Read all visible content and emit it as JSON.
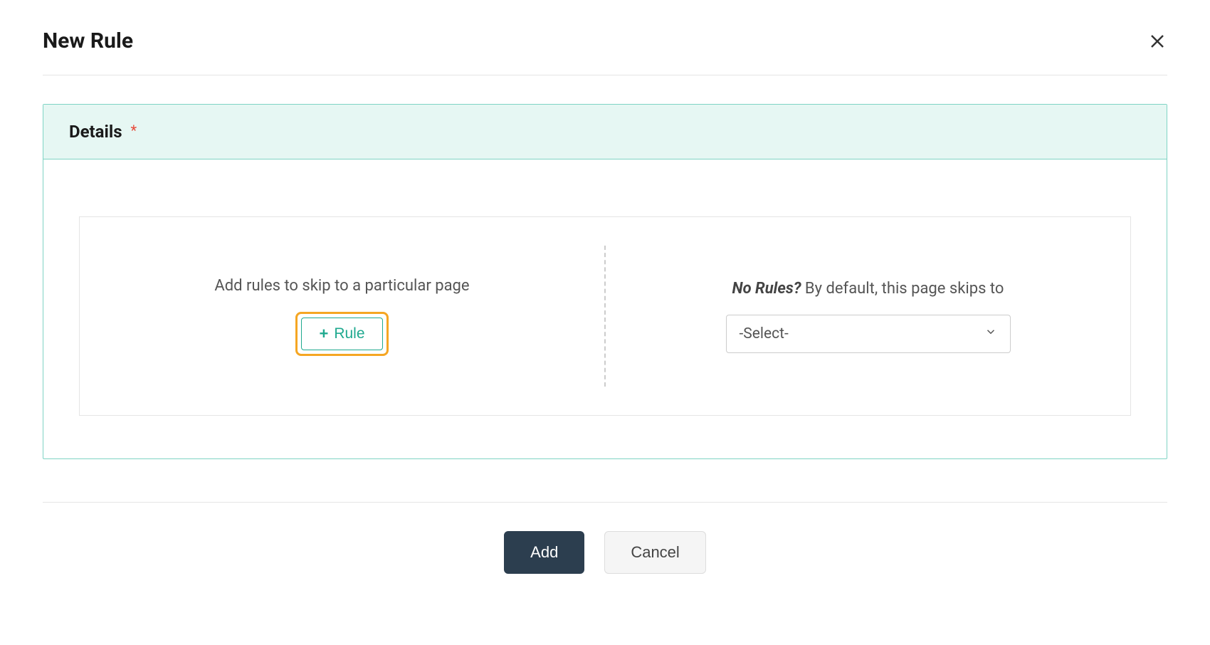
{
  "modal": {
    "title": "New Rule"
  },
  "details": {
    "header_label": "Details",
    "required_marker": "*",
    "left_panel": {
      "instruction": "Add rules to skip to a particular page",
      "rule_button_label": "Rule"
    },
    "right_panel": {
      "prefix_bold": "No Rules?",
      "suffix_text": " By default, this page skips to",
      "select_value": "-Select-"
    }
  },
  "footer": {
    "add_label": "Add",
    "cancel_label": "Cancel"
  }
}
